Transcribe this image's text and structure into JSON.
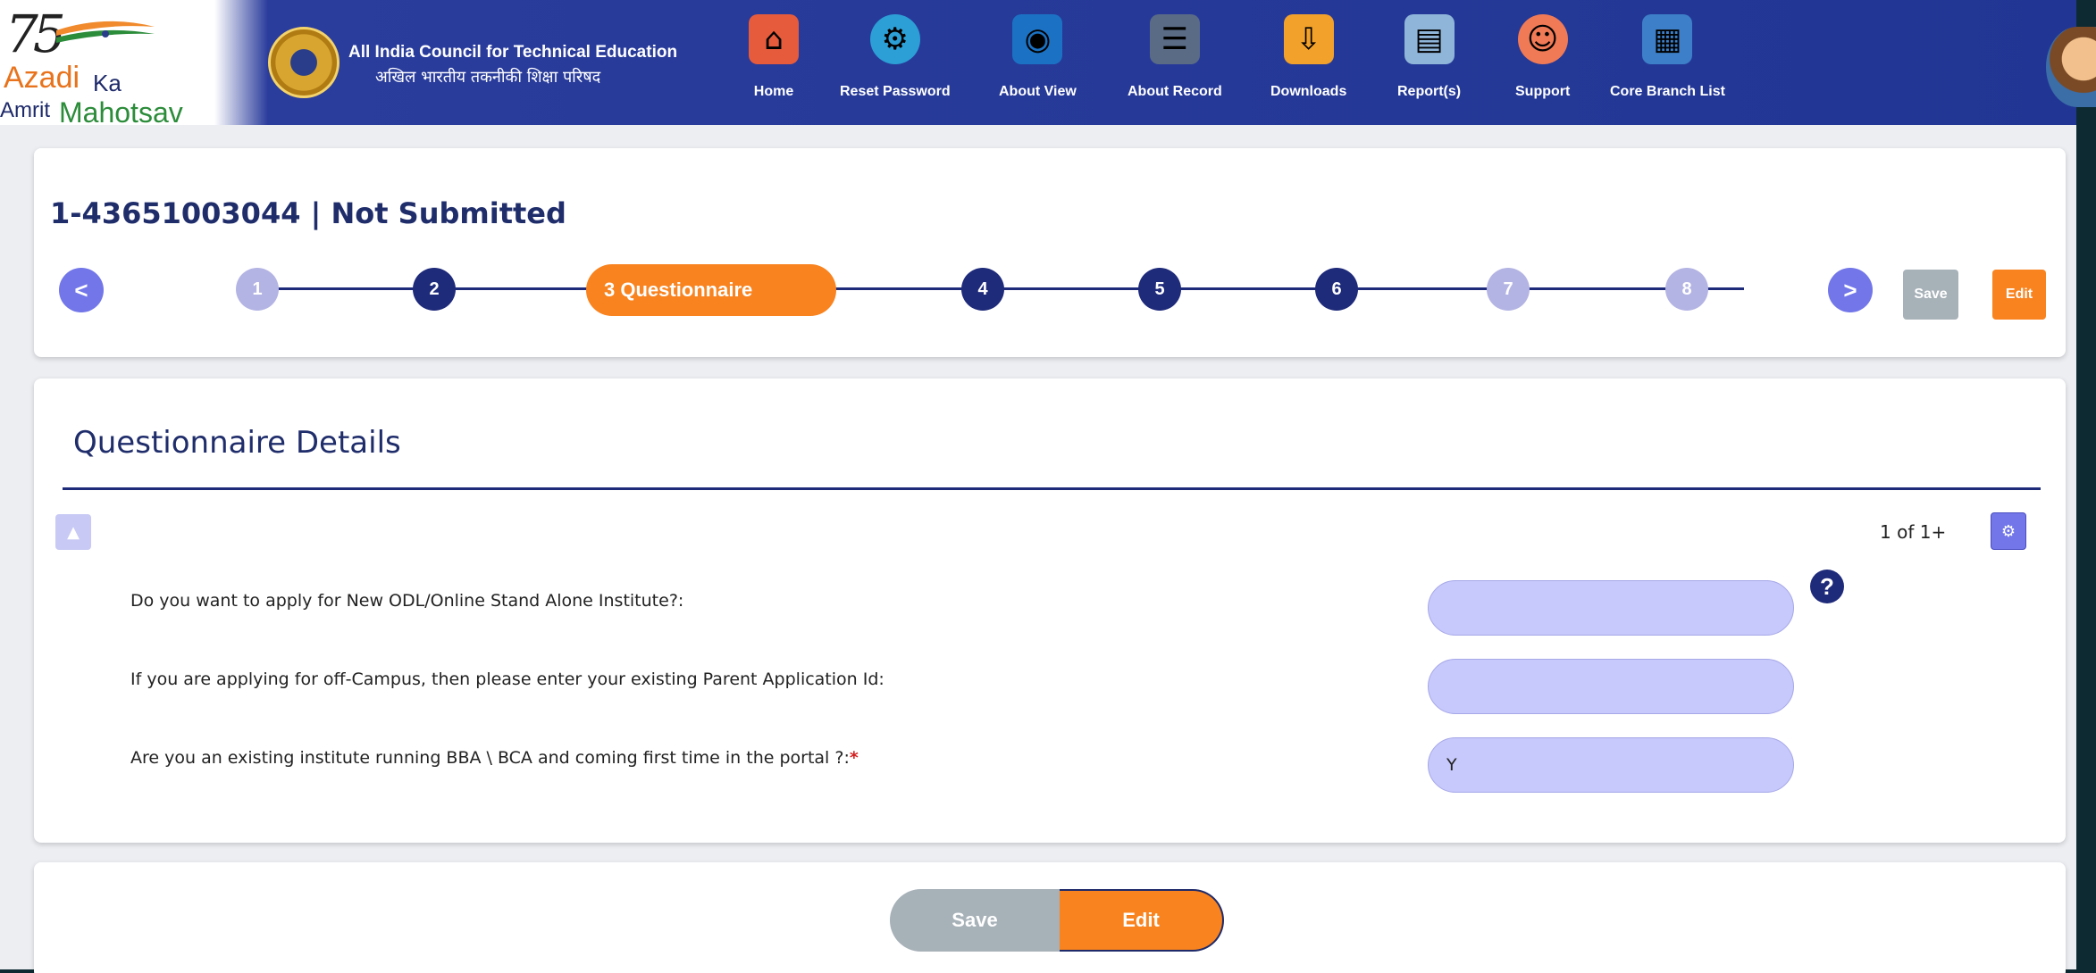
{
  "header": {
    "logo_text": {
      "num": "75",
      "azadi": "Azadi",
      "ka": "Ka",
      "amrit": "Amrit",
      "mahotsav": "Mahotsav"
    },
    "org_name_en": "All India Council for Technical Education",
    "org_name_hi": "अखिल भारतीय तकनीकी शिक्षा परिषद",
    "nav": [
      {
        "label": "Home",
        "icon": "home-icon",
        "color": "#e65b3c"
      },
      {
        "label": "Reset Password",
        "icon": "reset-password-icon",
        "color": "#2c9fd6"
      },
      {
        "label": "About View",
        "icon": "about-view-icon",
        "color": "#1b72c4"
      },
      {
        "label": "About Record",
        "icon": "about-record-icon",
        "color": "#5a6b86"
      },
      {
        "label": "Downloads",
        "icon": "downloads-icon",
        "color": "#f2a12a"
      },
      {
        "label": "Report(s)",
        "icon": "reports-icon",
        "color": "#8fb5d9"
      },
      {
        "label": "Support",
        "icon": "support-icon",
        "color": "#f07a55"
      },
      {
        "label": "Core Branch List",
        "icon": "core-branch-list-icon",
        "color": "#3d7fc8"
      }
    ]
  },
  "record": {
    "title": "1-43651003044 | Not Submitted"
  },
  "steps": {
    "prev": "<",
    "next": ">",
    "items": [
      {
        "label": "1",
        "state": "done"
      },
      {
        "label": "2",
        "state": "open"
      },
      {
        "label": "3  Questionnaire",
        "state": "active"
      },
      {
        "label": "4",
        "state": "open"
      },
      {
        "label": "5",
        "state": "open"
      },
      {
        "label": "6",
        "state": "open"
      },
      {
        "label": "7",
        "state": "done"
      },
      {
        "label": "8",
        "state": "done"
      }
    ],
    "save_label": "Save",
    "edit_label": "Edit"
  },
  "details": {
    "title": "Questionnaire Details",
    "pager": "1 of 1+",
    "questions": [
      {
        "label": "Do you want to apply for New ODL/Online Stand Alone Institute?:",
        "required": "",
        "value": ""
      },
      {
        "label": "If you are applying for off-Campus, then please enter your existing Parent Application Id:",
        "required": "",
        "value": ""
      },
      {
        "label": "Are you an existing institute running BBA \\ BCA and coming first time in the portal ?:",
        "required": "*",
        "value": "Y"
      }
    ],
    "help": "?"
  },
  "actions": {
    "save_label": "Save",
    "edit_label": "Edit"
  },
  "colors": {
    "header_blue": "#213694",
    "accent_orange": "#f8831f",
    "step_navy": "#1e2a7a",
    "step_done": "#b4b4e4",
    "input_bg": "#c7c8fb",
    "button_gray": "#a7b1b8"
  }
}
